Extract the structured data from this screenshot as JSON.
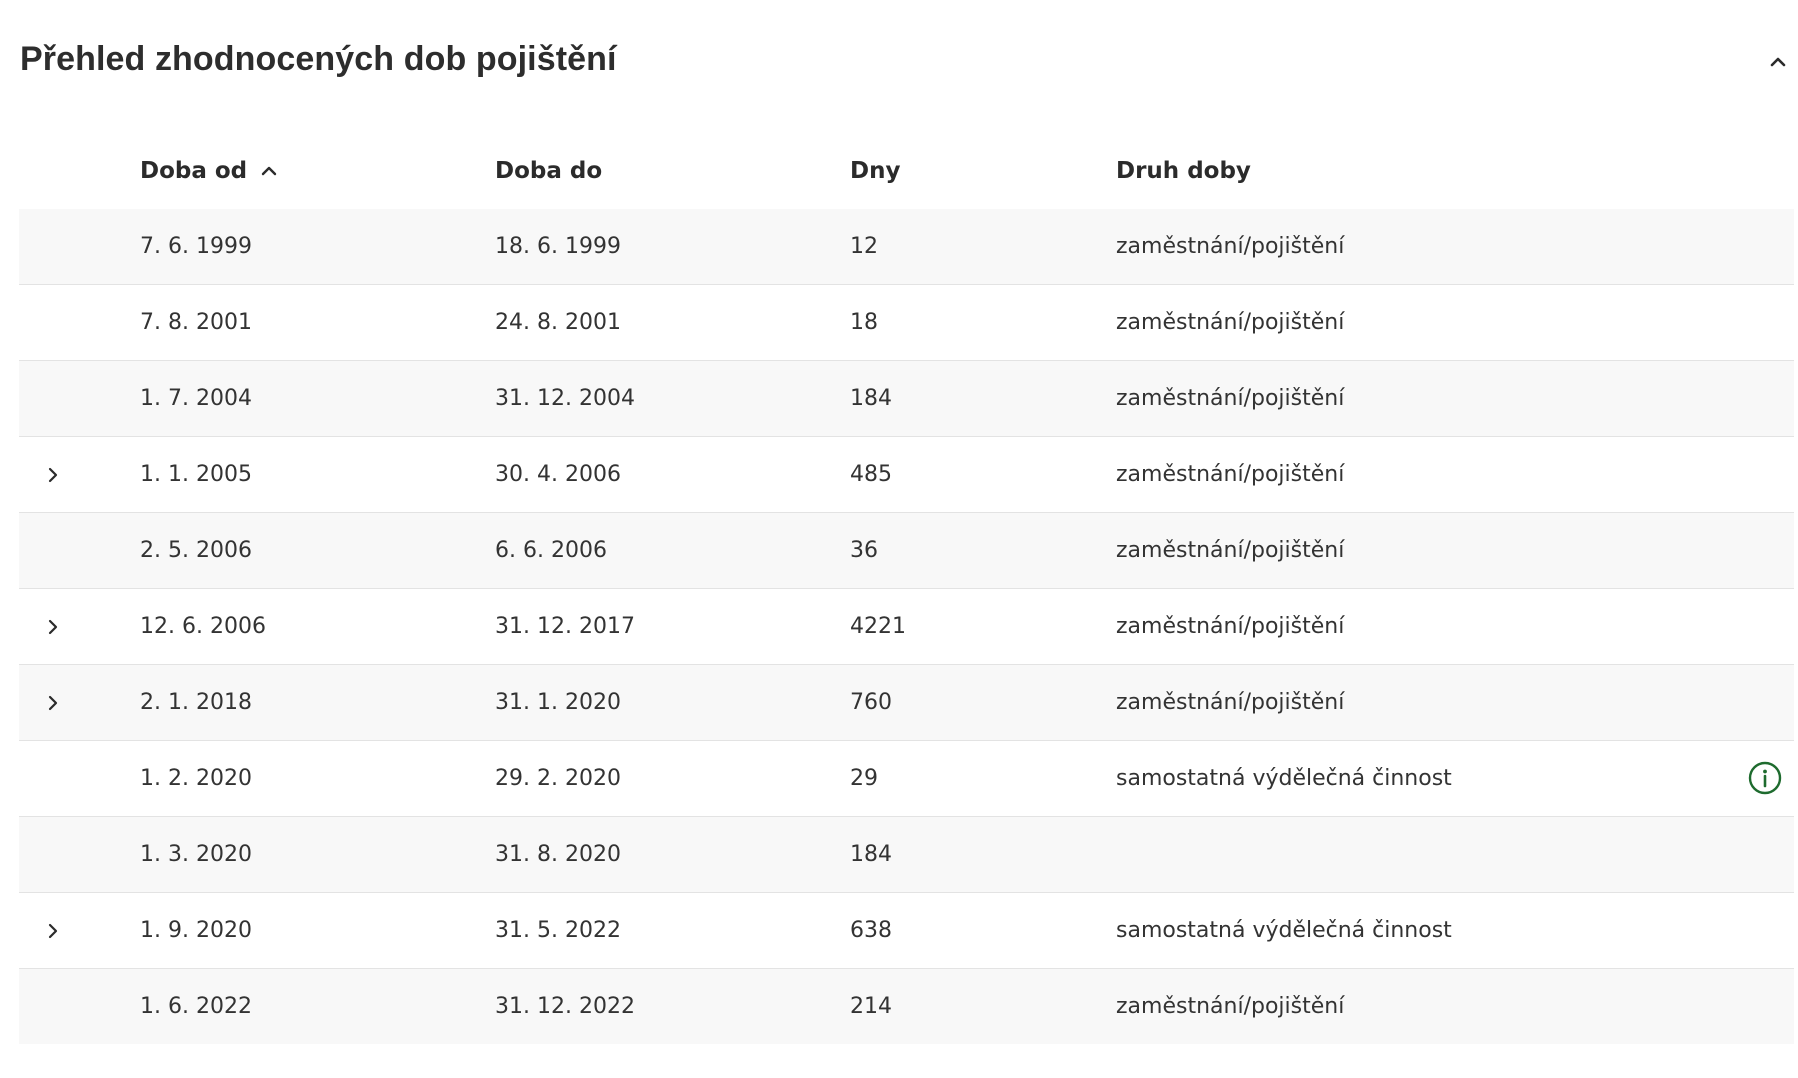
{
  "section": {
    "title": "Přehled zhodnocených dob pojištění"
  },
  "table": {
    "columns": {
      "from": "Doba od",
      "to": "Doba do",
      "days": "Dny",
      "kind": "Druh doby"
    },
    "sort": {
      "column": "from",
      "direction": "ascending"
    },
    "rows": [
      {
        "from": "7. 6. 1999",
        "to": "18. 6. 1999",
        "days": "12",
        "kind": "zaměstnání/pojištění",
        "expandable": false,
        "info": false
      },
      {
        "from": "7. 8. 2001",
        "to": "24. 8. 2001",
        "days": "18",
        "kind": "zaměstnání/pojištění",
        "expandable": false,
        "info": false
      },
      {
        "from": "1. 7. 2004",
        "to": "31. 12. 2004",
        "days": "184",
        "kind": "zaměstnání/pojištění",
        "expandable": false,
        "info": false
      },
      {
        "from": "1. 1. 2005",
        "to": "30. 4. 2006",
        "days": "485",
        "kind": "zaměstnání/pojištění",
        "expandable": true,
        "info": false
      },
      {
        "from": "2. 5. 2006",
        "to": "6. 6. 2006",
        "days": "36",
        "kind": "zaměstnání/pojištění",
        "expandable": false,
        "info": false
      },
      {
        "from": "12. 6. 2006",
        "to": "31. 12. 2017",
        "days": "4221",
        "kind": "zaměstnání/pojištění",
        "expandable": true,
        "info": false
      },
      {
        "from": "2. 1. 2018",
        "to": "31. 1. 2020",
        "days": "760",
        "kind": "zaměstnání/pojištění",
        "expandable": true,
        "info": false
      },
      {
        "from": "1. 2. 2020",
        "to": "29. 2. 2020",
        "days": "29",
        "kind": "samostatná výdělečná činnost",
        "expandable": false,
        "info": true
      },
      {
        "from": "1. 3. 2020",
        "to": "31. 8. 2020",
        "days": "184",
        "kind": "",
        "expandable": false,
        "info": false
      },
      {
        "from": "1. 9. 2020",
        "to": "31. 5. 2022",
        "days": "638",
        "kind": "samostatná výdělečná činnost",
        "expandable": true,
        "info": false
      },
      {
        "from": "1. 6. 2022",
        "to": "31. 12. 2022",
        "days": "214",
        "kind": "zaměstnání/pojištění",
        "expandable": false,
        "info": false
      }
    ]
  },
  "icons": {
    "collapse": "chevron-up-icon",
    "sort": "chevron-up-icon",
    "expand": "chevron-right-icon",
    "info": "info-circle-icon"
  },
  "colors": {
    "text": "#333333",
    "heading": "#2d2d2d",
    "row_stripe": "#f8f8f8",
    "row_divider": "#e3e3e3",
    "info_accent": "#1e6b2e"
  }
}
